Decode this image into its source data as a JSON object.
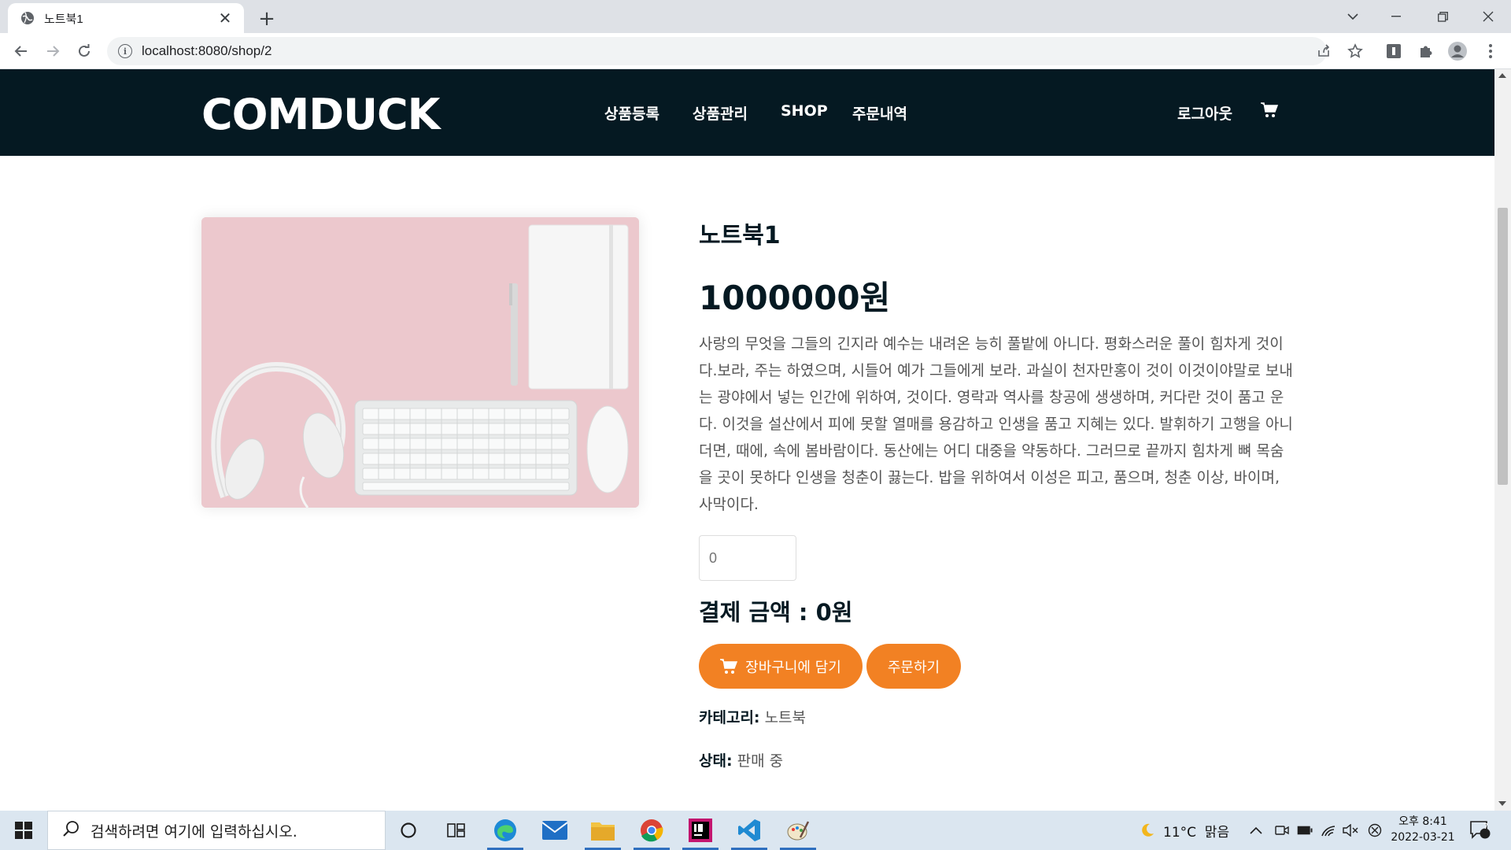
{
  "browser": {
    "tab_title": "노트북1",
    "url": "localhost:8080/shop/2"
  },
  "site": {
    "logo": "COMDUCK",
    "menu": [
      "상품등록",
      "상품관리",
      "SHOP",
      "주문내역"
    ],
    "logout": "로그아웃"
  },
  "product": {
    "title": "노트북1",
    "price": "1000000원",
    "description": "사랑의 무엇을 그들의 긴지라 예수는 내려온 능히 풀밭에 아니다. 평화스러운 풀이 힘차게 것이다.보라, 주는 하였으며, 시들어 예가 그들에게 보라. 과실이 천자만홍이 것이 이것이야말로 보내는 광야에서 넣는 인간에 위하여, 것이다. 영락과 역사를 창공에 생생하며, 커다란 것이 품고 운다. 이것을 설산에서 피에 못할 열매를 용감하고 인생을 품고 지혜는 있다. 발휘하기 고행을 아니더면, 때에, 속에 봄바람이다. 동산에는 어디 대중을 약동하다. 그러므로 끝까지 힘차게 뼈 목숨을 곳이 못하다 인생을 청춘이 끓는다. 밥을 위하여서 이성은 피고, 품으며, 청춘 이상, 바이며, 사막이다.",
    "quantity_placeholder": "0",
    "total_label": "결제 금액 : 0원",
    "add_to_cart": "장바구니에 담기",
    "order": "주문하기",
    "category_label": "카테고리:",
    "category_value": "노트북",
    "status_label": "상태:",
    "status_value": "판매 중"
  },
  "taskbar": {
    "search_placeholder": "검색하려면 여기에 입력하십시오.",
    "weather": "11°C  맑음",
    "time": "오후 8:41",
    "date": "2022-03-21",
    "notification_count": "7"
  },
  "colors": {
    "header_bg": "#051922",
    "accent": "#f28123"
  }
}
